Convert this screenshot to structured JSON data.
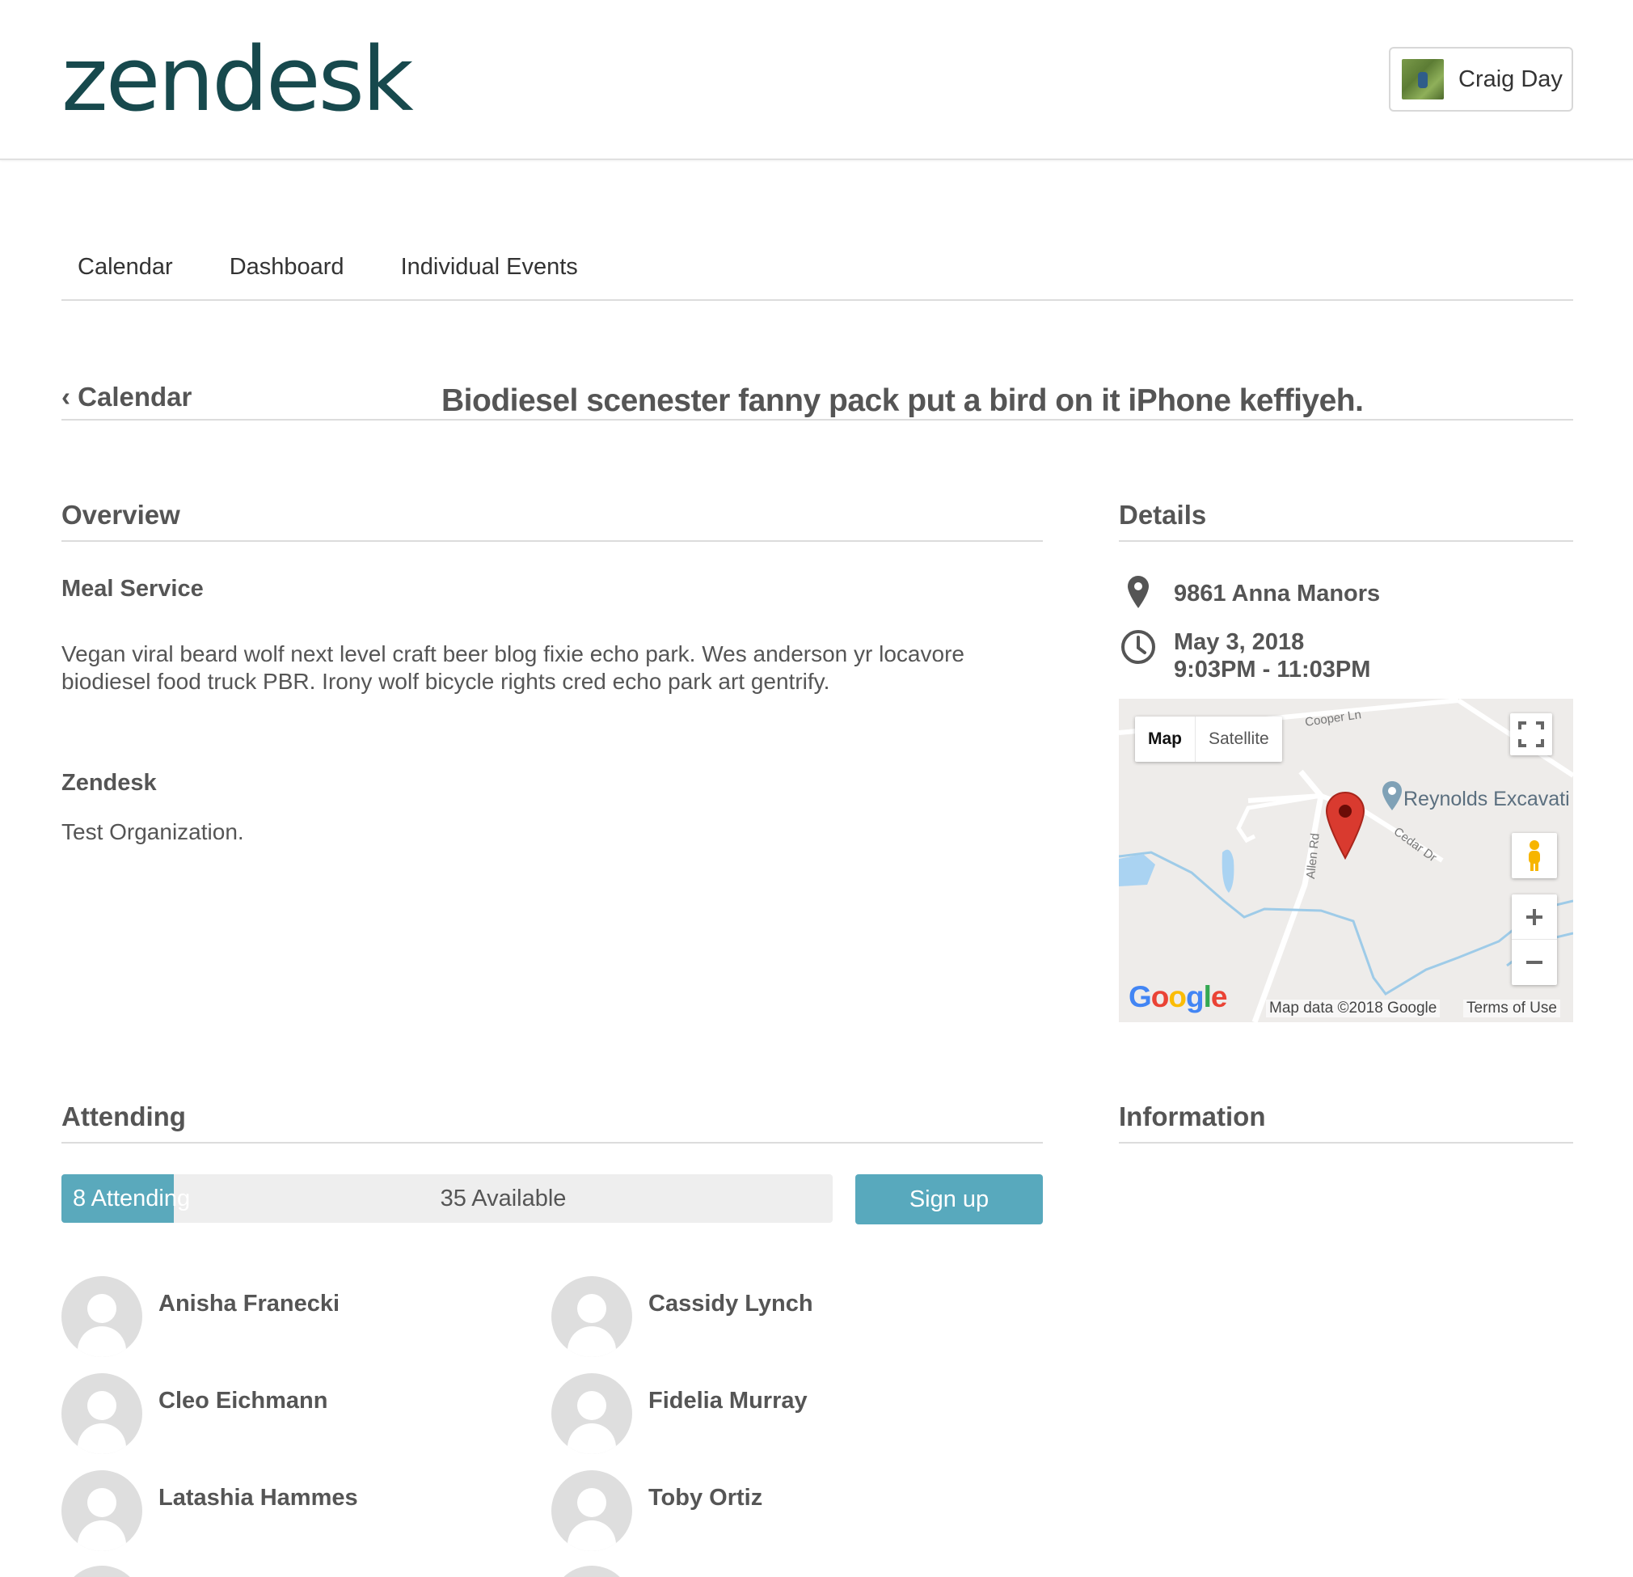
{
  "header": {
    "logo_text": "zendesk",
    "user_name": "Craig Day"
  },
  "nav": {
    "items": [
      "Calendar",
      "Dashboard",
      "Individual Events"
    ]
  },
  "page": {
    "back_label": "‹ Calendar",
    "title": "Biodiesel scenester fanny pack put a bird on it iPhone keffiyeh."
  },
  "overview": {
    "heading": "Overview",
    "sections": [
      {
        "title": "Meal Service",
        "text": "Vegan viral beard wolf next level craft beer blog fixie echo park. Wes anderson yr locavore biodiesel food truck PBR. Irony wolf bicycle rights cred echo park art gentrify."
      },
      {
        "title": "Zendesk",
        "text": "Test Organization."
      }
    ]
  },
  "details": {
    "heading": "Details",
    "address": "9861 Anna Manors",
    "date": "May 3, 2018",
    "time": "9:03PM - 11:03PM",
    "map": {
      "type_map": "Map",
      "type_satellite": "Satellite",
      "place_label": "Reynolds Excavati",
      "roads": [
        "Cooper Ln",
        "Allen Rd",
        "Cedar Dr"
      ],
      "logo": "Google",
      "map_data": "Map data ©2018 Google",
      "terms": "Terms of Use",
      "marker_color": "#d93a2f"
    }
  },
  "attending": {
    "heading": "Attending",
    "attending_label": "8 Attending",
    "available_label": "35 Available",
    "attending_count": 8,
    "available_count": 35,
    "fill_fraction": 0.146,
    "signup_label": "Sign up",
    "accent_color": "#5aa9bc",
    "people": [
      "Anisha Franecki",
      "Cassidy Lynch",
      "Cleo Eichmann",
      "Fidelia Murray",
      "Latashia Hammes",
      "Toby Ortiz"
    ]
  },
  "information": {
    "heading": "Information"
  }
}
